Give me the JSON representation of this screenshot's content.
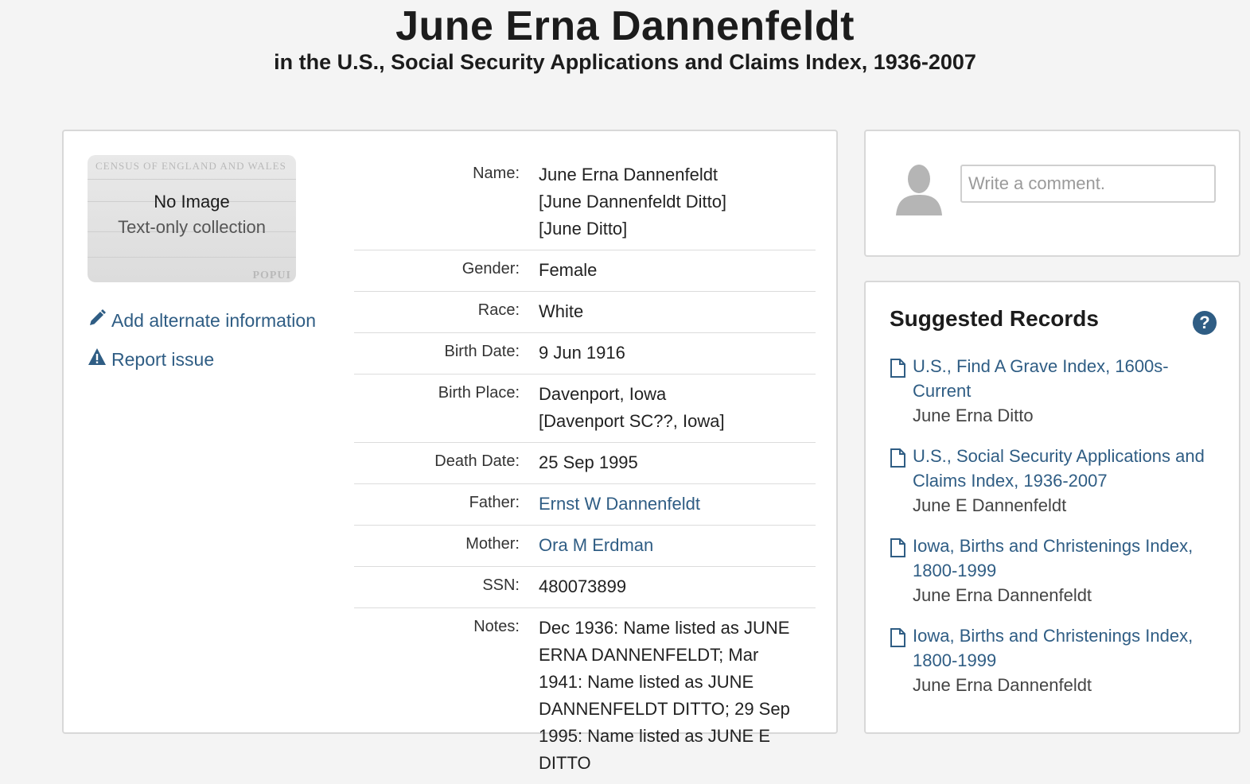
{
  "header": {
    "title": "June Erna Dannenfeldt",
    "subtitle": "in the U.S., Social Security Applications and Claims Index, 1936-2007"
  },
  "thumbnail": {
    "main": "No Image",
    "sub": "Text-only collection",
    "bg_text_top": "CENSUS OF ENGLAND AND WALES",
    "bg_text_bottom": "POPUI"
  },
  "actions": {
    "add_alternate": "Add alternate information",
    "report_issue": "Report issue"
  },
  "facts": [
    {
      "label": "Name:",
      "lines": [
        "June Erna Dannenfeldt",
        "[June Dannenfeldt Ditto]",
        "[June Ditto]"
      ],
      "link": false
    },
    {
      "label": "Gender:",
      "lines": [
        "Female"
      ],
      "link": false
    },
    {
      "label": "Race:",
      "lines": [
        "White"
      ],
      "link": false
    },
    {
      "label": "Birth Date:",
      "lines": [
        "9 Jun 1916"
      ],
      "link": false
    },
    {
      "label": "Birth Place:",
      "lines": [
        "Davenport, Iowa",
        "[Davenport SC??, Iowa]"
      ],
      "link": false
    },
    {
      "label": "Death Date:",
      "lines": [
        "25 Sep 1995"
      ],
      "link": false
    },
    {
      "label": "Father:",
      "lines": [
        "Ernst W Dannenfeldt"
      ],
      "link": true
    },
    {
      "label": "Mother:",
      "lines": [
        "Ora M Erdman"
      ],
      "link": true
    },
    {
      "label": "SSN:",
      "lines": [
        "480073899"
      ],
      "link": false
    },
    {
      "label": "Notes:",
      "lines": [
        "Dec 1936: Name listed as JUNE ERNA DANNENFELDT; Mar 1941: Name listed as JUNE DANNENFELDT DITTO; 29 Sep 1995: Name listed as JUNE E DITTO"
      ],
      "link": false
    }
  ],
  "comment": {
    "placeholder": "Write a comment."
  },
  "suggested": {
    "title": "Suggested Records",
    "help": "?",
    "items": [
      {
        "collection": "U.S., Find A Grave Index, 1600s-Current",
        "person": "June Erna Ditto"
      },
      {
        "collection": "U.S., Social Security Applications and Claims Index, 1936-2007",
        "person": "June E Dannenfeldt"
      },
      {
        "collection": "Iowa, Births and Christenings Index, 1800-1999",
        "person": "June Erna Dannenfeldt"
      },
      {
        "collection": "Iowa, Births and Christenings Index, 1800-1999",
        "person": "June Erna Dannenfeldt"
      }
    ]
  },
  "colors": {
    "link": "#2f5d84",
    "background": "#f4f4f4",
    "card_border": "#d8d8d8"
  }
}
